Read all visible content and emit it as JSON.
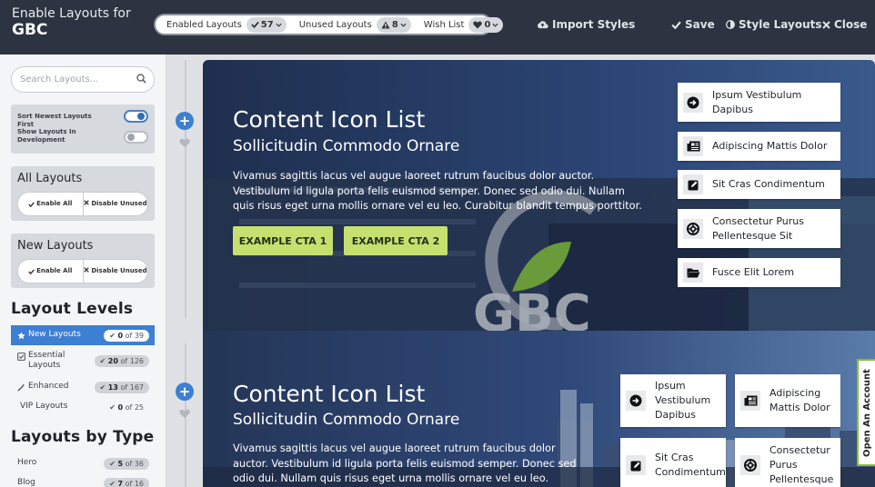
{
  "header": {
    "title_line1": "Enable Layouts for",
    "title_line2": "GBC",
    "pills": [
      {
        "label": "Enabled Layouts",
        "icon": "check-icon",
        "count": "57"
      },
      {
        "label": "Unused Layouts",
        "icon": "warning-icon",
        "count": "8"
      },
      {
        "label": "Wish List",
        "icon": "heart-icon",
        "count": "0"
      }
    ],
    "import_label": "Import Styles",
    "save_label": "Save",
    "style_label": "Style Layouts",
    "close_label": "Close"
  },
  "sidebar": {
    "search_placeholder": "Search Layouts...",
    "toggles": [
      {
        "label": "Sort Newest Layouts First",
        "on": true
      },
      {
        "label": "Show Layouts In Development",
        "on": false
      }
    ],
    "all_layouts": {
      "title": "All Layouts",
      "enable": "Enable All",
      "disable": "Disable Unused"
    },
    "new_layouts": {
      "title": "New Layouts",
      "enable": "Enable All",
      "disable": "Disable Unused"
    },
    "levels_title": "Layout Levels",
    "levels": [
      {
        "name": "New Layouts",
        "count": "0",
        "total": "of 39"
      },
      {
        "name": "Essential Layouts",
        "count": "20",
        "total": "of 126"
      },
      {
        "name": "Enhanced",
        "count": "13",
        "total": "of 167"
      },
      {
        "name": "VIP Layouts",
        "count": "0",
        "total": "of 25"
      }
    ],
    "types_title": "Layouts by Type",
    "types": [
      {
        "name": "Hero",
        "count": "5",
        "total": "of 36"
      },
      {
        "name": "Blog",
        "count": "7",
        "total": "of 16"
      }
    ]
  },
  "preview1": {
    "title": "Content Icon List",
    "subtitle": "Sollicitudin Commodo Ornare",
    "body": "Vivamus sagittis lacus vel augue laoreet rutrum faucibus dolor auctor. Vestibulum id ligula porta felis euismod semper. Donec sed odio dui. Nullam quis risus eget urna mollis ornare vel eu leo. Curabitur blandit tempus porttitor.",
    "cta1": "EXAMPLE CTA 1",
    "cta2": "EXAMPLE CTA 2",
    "logo_text": "GBC",
    "items": [
      "Ipsum Vestibulum Dapibus",
      "Adipiscing Mattis Dolor",
      "Sit Cras Condimentum",
      "Consectetur Purus Pellentesque Sit",
      "Fusce Elit Lorem"
    ]
  },
  "preview2": {
    "title": "Content Icon List",
    "subtitle": "Sollicitudin Commodo Ornare",
    "body": "Vivamus sagittis lacus vel augue laoreet rutrum faucibus dolor auctor. Vestibulum id ligula porta felis euismod semper. Donec sed odio dui. Nullam quis risus eget urna mollis ornare vel eu leo. Curabitur blandit",
    "items": [
      "Ipsum Vestibulum Dapibus",
      "Adipiscing Mattis Dolor",
      "Sit Cras Condimentum",
      "Consectetur Purus Pellentesque"
    ]
  },
  "account_tab": "Open An Account",
  "colors": {
    "accent": "#3d7fd3",
    "cta": "#c5e06e",
    "topbar": "#2d3340"
  }
}
